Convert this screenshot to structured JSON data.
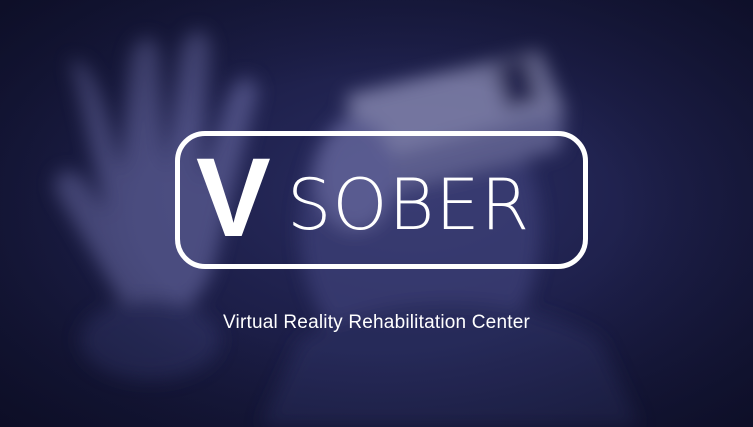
{
  "logo": {
    "mark": "V",
    "word": "SOBER"
  },
  "tagline": "Virtual Reality Rehabilitation Center",
  "colors": {
    "background": "#1d1f49",
    "overlay": "#2a2d62",
    "text": "#ffffff"
  }
}
